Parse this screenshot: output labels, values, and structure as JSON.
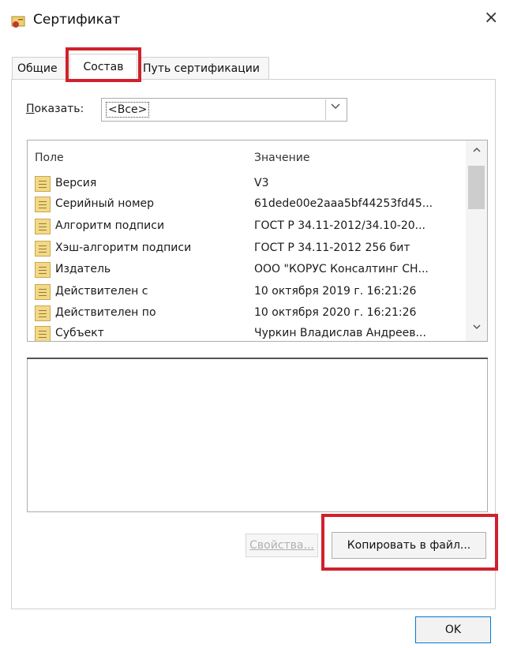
{
  "window": {
    "title": "Сертификат",
    "close_glyph": "×",
    "icon": "certificate-icon"
  },
  "tabs": [
    {
      "label": "Общие"
    },
    {
      "label": "Состав",
      "active": true
    },
    {
      "label": "Путь сертификации"
    }
  ],
  "show": {
    "label_prefix": "П",
    "label_rest": "оказать:",
    "selected": "<Все>"
  },
  "list": {
    "col_field": "Поле",
    "col_value": "Значение",
    "rows": [
      {
        "field": "Версия",
        "value": "V3"
      },
      {
        "field": "Серийный номер",
        "value": "61dede00e2aaa5bf44253fd45..."
      },
      {
        "field": "Алгоритм подписи",
        "value": "ГОСТ Р 34.11-2012/34.10-20..."
      },
      {
        "field": "Хэш-алгоритм подписи",
        "value": "ГОСТ Р 34.11-2012 256 бит"
      },
      {
        "field": "Издатель",
        "value": "ООО \"КОРУС Консалтинг СН..."
      },
      {
        "field": "Действителен с",
        "value": "10 октября 2019 г. 16:21:26"
      },
      {
        "field": "Действителен по",
        "value": "10 октября 2020 г. 16:21:26"
      },
      {
        "field": "Субъект",
        "value": "Чуркин Владислав Андреев..."
      }
    ]
  },
  "buttons": {
    "properties": "Свойства...",
    "copy_to_file": "Копировать в файл...",
    "ok": "OK"
  },
  "colors": {
    "highlight": "#d0212c",
    "focus": "#0078d7"
  }
}
